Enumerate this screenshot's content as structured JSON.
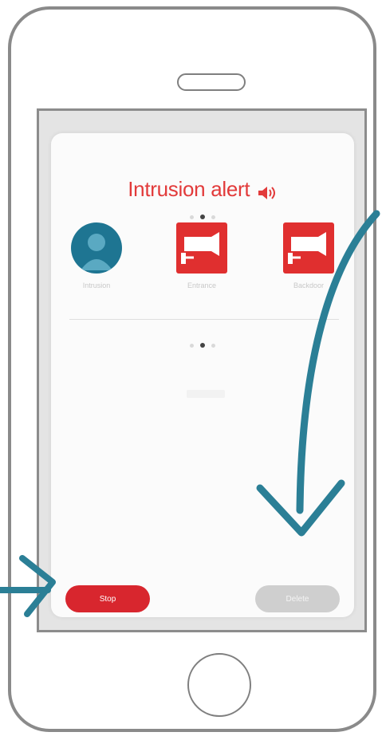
{
  "colors": {
    "accent_red": "#e23a3a",
    "avatar_teal": "#1e7592",
    "annotation_arrow": "#2b7f96",
    "frame_grey": "#8a8a8a"
  },
  "alert": {
    "title": "Intrusion alert",
    "icon": "speaker-sound-icon"
  },
  "pager_top": {
    "count": 3,
    "active_index": 1
  },
  "pager_bottom": {
    "count": 3,
    "active_index": 1
  },
  "devices": [
    {
      "kind": "avatar",
      "icon": "user-avatar-icon",
      "label": "Intrusion"
    },
    {
      "kind": "camera",
      "icon": "camera-icon",
      "label": "Entrance"
    },
    {
      "kind": "camera",
      "icon": "camera-icon",
      "label": "Backdoor"
    }
  ],
  "buttons": {
    "left_label": "Stop",
    "right_label": "Delete"
  },
  "annotations": {
    "arrow_left": "pointing-arrow-icon",
    "arrow_curve": "curved-arrow-icon"
  }
}
